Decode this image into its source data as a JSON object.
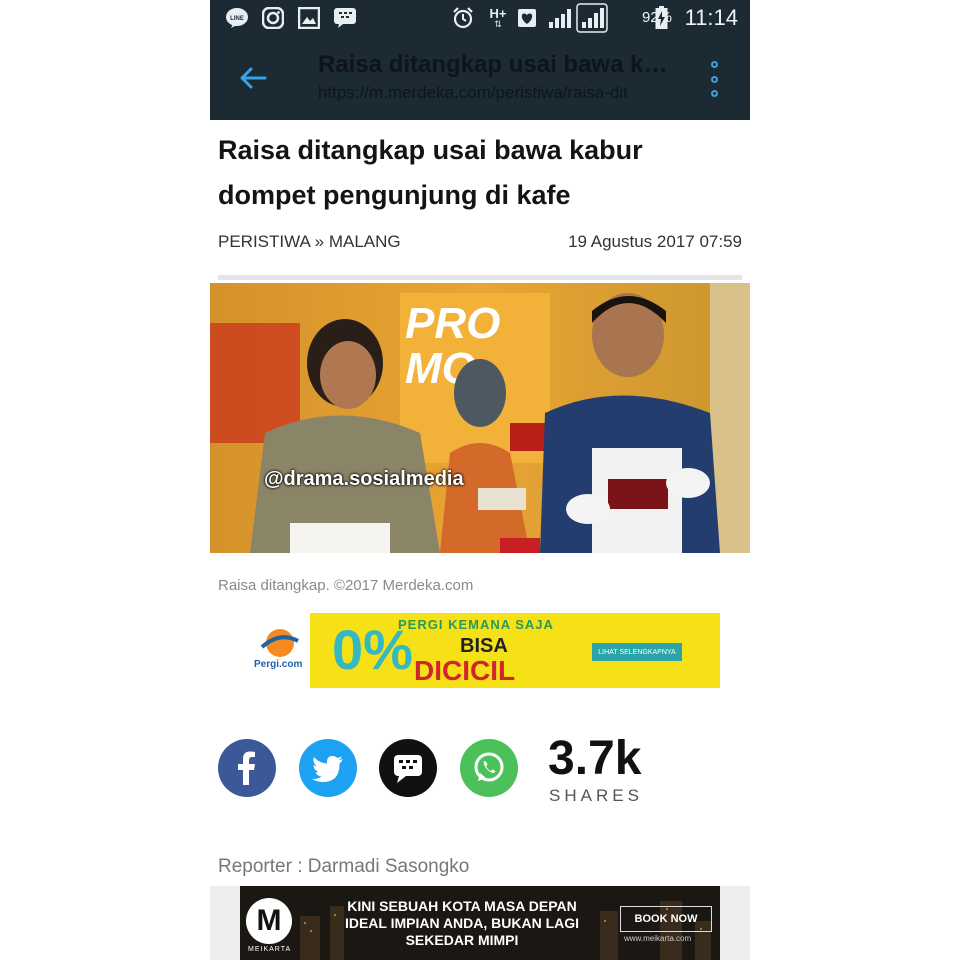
{
  "status_bar": {
    "battery": "92%",
    "time": "11:14",
    "network": "H+",
    "icons": [
      "line-icon",
      "instagram-icon",
      "gallery-icon",
      "bbm-icon",
      "alarm-icon",
      "network-h-plus-icon",
      "heart-icon",
      "signal-icon",
      "signal-icon",
      "battery-icon"
    ]
  },
  "toolbar": {
    "title": "Raisa ditangkap usai bawa k…",
    "url": "https://m.merdeka.com/peristiwa/raisa-dit"
  },
  "article": {
    "headline": "Raisa ditangkap usai bawa kabur dompet pengunjung di kafe",
    "category": "PERISTIWA » MALANG",
    "date": "19 Agustus 2017 07:59",
    "photo_watermark": "@drama.sosialmedia",
    "caption": "Raisa ditangkap. ©2017 Merdeka.com",
    "reporter": "Reporter : Darmadi Sasongko"
  },
  "ad_top": {
    "brand": "Pergi.com",
    "line1": "PERGI KEMANA SAJA",
    "line2": "BISA",
    "line3": "DICICIL",
    "big_number": "0%",
    "button": "LIHAT SELENGKAPNYA"
  },
  "share": {
    "count": "3.7k",
    "label": "SHARES",
    "buttons": [
      "facebook",
      "twitter",
      "bbm",
      "whatsapp"
    ],
    "colors": {
      "facebook": "#3b5998",
      "twitter": "#1da1f2",
      "bbm": "#111111",
      "whatsapp": "#4cc15a"
    }
  },
  "ad_bottom": {
    "brand": "MEIKARTA",
    "text": "KINI SEBUAH KOTA MASA DEPAN IDEAL IMPIAN ANDA, BUKAN LAGI SEKEDAR MIMPI",
    "button": "BOOK NOW",
    "url": "www.meikarta.com"
  }
}
